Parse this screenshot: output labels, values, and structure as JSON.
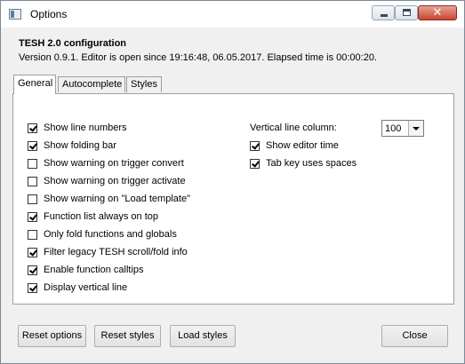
{
  "window": {
    "title": "Options",
    "icon": "app-window-icon"
  },
  "header": {
    "title": "TESH 2.0 configuration",
    "version_line": "Version 0.9.1. Editor is open since 19:16:48, 06.05.2017. Elapsed time is 00:00:20."
  },
  "tabs": [
    {
      "label": "General",
      "active": true
    },
    {
      "label": "Autocomplete",
      "active": false
    },
    {
      "label": "Styles",
      "active": false
    }
  ],
  "options_left": [
    {
      "label": "Show line numbers",
      "checked": true
    },
    {
      "label": "Show folding bar",
      "checked": true
    },
    {
      "label": "Show warning on trigger convert",
      "checked": false
    },
    {
      "label": "Show warning on trigger activate",
      "checked": false
    },
    {
      "label": "Show warning on \"Load template\"",
      "checked": false
    },
    {
      "label": "Function list always on top",
      "checked": true
    },
    {
      "label": "Only fold functions and globals",
      "checked": false
    },
    {
      "label": "Filter legacy TESH scroll/fold info",
      "checked": true
    },
    {
      "label": "Enable function calltips",
      "checked": true
    },
    {
      "label": "Display vertical line",
      "checked": true
    }
  ],
  "vertical_line": {
    "label": "Vertical line column:",
    "value": "100"
  },
  "options_right": [
    {
      "label": "Show editor time",
      "checked": true
    },
    {
      "label": "Tab key uses spaces",
      "checked": true
    }
  ],
  "buttons": {
    "reset_options": "Reset options",
    "reset_styles": "Reset styles",
    "load_styles": "Load styles",
    "close": "Close"
  },
  "titlebar_buttons": {
    "close_glyph": "✕"
  }
}
